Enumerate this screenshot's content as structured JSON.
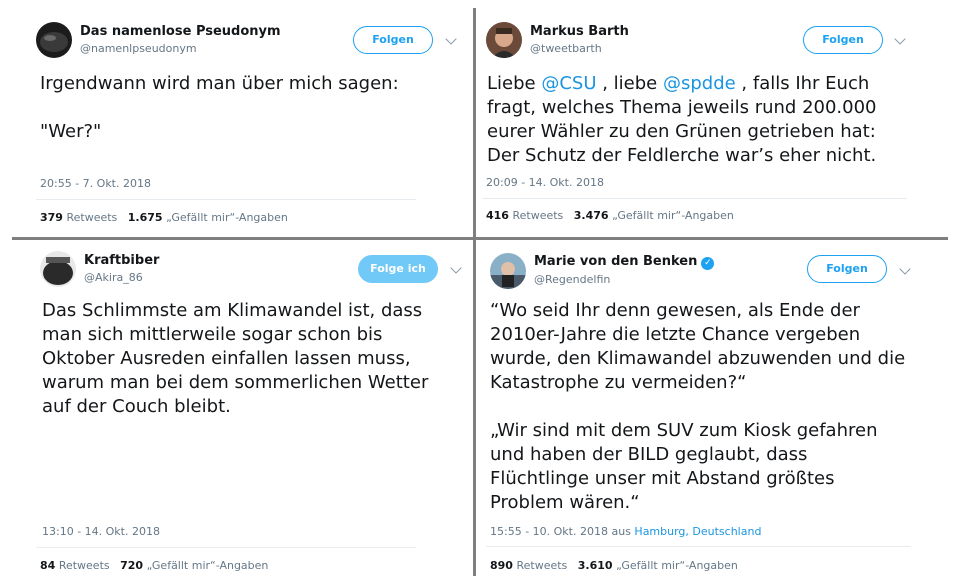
{
  "tweets": [
    {
      "name": "Das namenlose Pseudonym",
      "handle": "@namenlpseudonym",
      "follow_label": "Folgen",
      "text": "Irgendwann wird man über mich sagen:\n\n\"Wer?\"",
      "timestamp": "20:55 - 7. Okt. 2018",
      "retweets": "379",
      "retweets_label": "Retweets",
      "likes": "1.675",
      "likes_label": "„Gefällt mir“-Angaben"
    },
    {
      "name": "Markus Barth",
      "handle": "@tweetbarth",
      "follow_label": "Folgen",
      "text_parts": [
        "Liebe ",
        "@CSU",
        " , liebe ",
        "@spdde",
        " , falls Ihr Euch\nfragt, welches Thema jeweils rund 200.000\neurer Wähler zu den Grünen getrieben hat:\nDer Schutz der Feldlerche war’s eher nicht."
      ],
      "timestamp": "20:09 - 14. Okt. 2018",
      "retweets": "416",
      "retweets_label": "Retweets",
      "likes": "3.476",
      "likes_label": "„Gefällt mir“-Angaben"
    },
    {
      "name": "Kraftbiber",
      "handle": "@Akira_86",
      "follow_label": "Folge ich",
      "text": "Das Schlimmste am Klimawandel ist, dass\nman sich mittlerweile sogar schon bis\nOktober Ausreden einfallen lassen muss,\nwarum man bei dem sommerlichen Wetter\nauf der Couch bleibt.",
      "timestamp": "13:10 - 14. Okt. 2018",
      "retweets": "84",
      "retweets_label": "Retweets",
      "likes": "720",
      "likes_label": "„Gefällt mir“-Angaben"
    },
    {
      "name": "Marie von den Benken",
      "handle": "@Regendelfin",
      "follow_label": "Folgen",
      "text": "“Wo seid Ihr denn gewesen, als Ende der\n2010er-Jahre die letzte Chance vergeben\nwurde, den Klimawandel abzuwenden und die\nKatastrophe zu vermeiden?“\n\n„Wir sind mit dem SUV zum Kiosk gefahren\nund haben der BILD geglaubt, dass\nFlüchtlinge unser mit Abstand größtes\nProblem wären.“",
      "timestamp_prefix": "15:55 - 10. Okt. 2018 aus ",
      "location": "Hamburg, Deutschland",
      "retweets": "890",
      "retweets_label": "Retweets",
      "likes": "3.610",
      "likes_label": "„Gefällt mir“-Angaben"
    }
  ],
  "colors": {
    "accent": "#1da1f2",
    "mention": "#1b95e0",
    "muted": "#657786",
    "divider": "#7f7f7f"
  },
  "icons": [
    "chevron-down-icon",
    "verified-badge-icon"
  ]
}
